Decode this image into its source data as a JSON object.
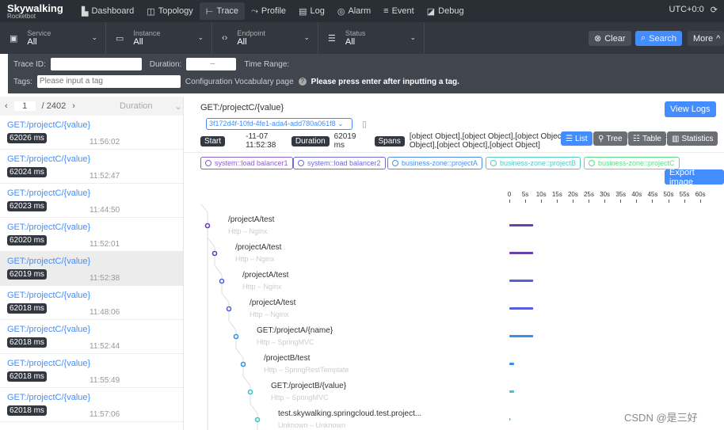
{
  "nav": {
    "logo": "Skywalking",
    "sub": "Rocketbot",
    "items": [
      {
        "label": "Dashboard",
        "icon": "dashboard-icon"
      },
      {
        "label": "Topology",
        "icon": "topology-icon"
      },
      {
        "label": "Trace",
        "icon": "trace-icon",
        "active": true
      },
      {
        "label": "Profile",
        "icon": "profile-icon"
      },
      {
        "label": "Log",
        "icon": "log-icon"
      },
      {
        "label": "Alarm",
        "icon": "alarm-icon"
      },
      {
        "label": "Event",
        "icon": "event-icon"
      },
      {
        "label": "Debug",
        "icon": "debug-icon"
      }
    ],
    "timezone": "UTC+0:0"
  },
  "filters": [
    {
      "label": "Service",
      "value": "All"
    },
    {
      "label": "Instance",
      "value": "All"
    },
    {
      "label": "Endpoint",
      "value": "All"
    },
    {
      "label": "Status",
      "value": "All"
    }
  ],
  "actions": {
    "clear": "Clear",
    "search": "Search",
    "more": "More"
  },
  "more": {
    "trace_id": "Trace ID:",
    "duration": "Duration:",
    "duration_sep": "–",
    "time_range": "Time Range:",
    "tags": "Tags:",
    "tags_placeholder": "Please input a tag",
    "vocab": "Configuration Vocabulary page",
    "hint": "Please press enter after inputting a tag."
  },
  "list": {
    "page": "1",
    "total": "/ 2402",
    "sort": "Duration",
    "items": [
      {
        "title": "GET:/projectC/{value}",
        "duration": "62026 ms",
        "time": "11:56:02"
      },
      {
        "title": "GET:/projectC/{value}",
        "duration": "62024 ms",
        "time": "11:52:47"
      },
      {
        "title": "GET:/projectC/{value}",
        "duration": "62023 ms",
        "time": "11:44:50"
      },
      {
        "title": "GET:/projectC/{value}",
        "duration": "62020 ms",
        "time": "11:52:01"
      },
      {
        "title": "GET:/projectC/{value}",
        "duration": "62019 ms",
        "time": "11:52:38",
        "selected": true
      },
      {
        "title": "GET:/projectC/{value}",
        "duration": "62018 ms",
        "time": "11:48:06"
      },
      {
        "title": "GET:/projectC/{value}",
        "duration": "62018 ms",
        "time": "11:52:44"
      },
      {
        "title": "GET:/projectC/{value}",
        "duration": "62018 ms",
        "time": "11:55:49"
      },
      {
        "title": "GET:/projectC/{value}",
        "duration": "62018 ms",
        "time": "11:57:06"
      }
    ]
  },
  "detail": {
    "title": "GET:/projectC/{value}",
    "trace_id": "3f172d4f-10fd-4fe1-ada4-add780a061f8",
    "start_label": "Start",
    "start": "-11-07 11:52:38",
    "duration_label": "Duration",
    "duration": "62019 ms",
    "spans_label": "Spans",
    "spans": [
      {
        "name": "/projectA/test",
        "sub": "Http – Nginx",
        "color": "#6a3fb0",
        "duration_s": 7.5
      },
      {
        "name": "/projectA/test",
        "sub": "Http – Nginx",
        "color": "#6a3fb0",
        "duration_s": 7.5
      },
      {
        "name": "/projectA/test",
        "sub": "Http – Nginx",
        "color": "#5660d8",
        "duration_s": 7.5
      },
      {
        "name": "/projectA/test",
        "sub": "Http – Nginx",
        "color": "#5660d8",
        "duration_s": 7.5
      },
      {
        "name": "GET:/projectA/{name}",
        "sub": "Http – SpringMVC",
        "color": "#3a8ee8",
        "duration_s": 7.5
      },
      {
        "name": "/projectB/test",
        "sub": "Http – SpringRestTemplate",
        "color": "#3a8ee8",
        "duration_s": 1.5
      },
      {
        "name": "GET:/projectB/{value}",
        "sub": "Http – SpringMVC",
        "color": "#40c4c4",
        "duration_s": 1.5
      },
      {
        "name": "test.skywalking.springcloud.test.project...",
        "sub": "Unknown – Unknown",
        "color": "#40c4c4",
        "duration_s": 0.3
      }
    ],
    "view_logs": "View Logs",
    "export": "Export image",
    "views": [
      {
        "label": "List",
        "icon": "list-icon",
        "active": true
      },
      {
        "label": "Tree",
        "icon": "tree-icon"
      },
      {
        "label": "Table",
        "icon": "table-icon"
      },
      {
        "label": "Statistics",
        "icon": "statistics-icon"
      }
    ],
    "legend": [
      {
        "label": "system::load balancer1",
        "color": "#8e5fc8"
      },
      {
        "label": "system::load balancer2",
        "color": "#6e6ad8"
      },
      {
        "label": "business-zone::projectA",
        "color": "#4c8fe8"
      },
      {
        "label": "business-zone::projectB",
        "color": "#4fc9c4"
      },
      {
        "label": "business-zone::projectC",
        "color": "#5edc8a"
      }
    ],
    "axis": [
      "0",
      "5s",
      "10s",
      "15s",
      "20s",
      "25s",
      "30s",
      "35s",
      "40s",
      "45s",
      "50s",
      "55s",
      "60s"
    ]
  },
  "watermark": "CSDN @是三好"
}
